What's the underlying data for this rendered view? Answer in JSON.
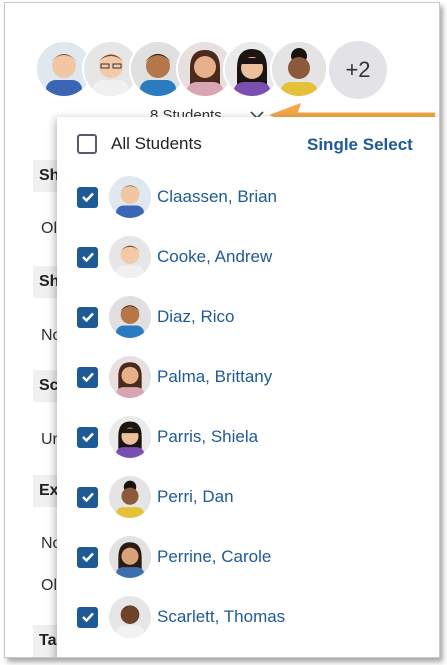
{
  "header": {
    "avatars": [
      {
        "name": "Claassen, Brian",
        "skin": "#f1c7a3",
        "hair": "#8a5a2b",
        "bg": "#dfe7ef",
        "shirt": "#3b66b5"
      },
      {
        "name": "Cooke, Andrew",
        "skin": "#f3c9a8",
        "hair": "#6d4727",
        "bg": "#e6e6e6",
        "shirt": "#f0f0f0"
      },
      {
        "name": "Diaz, Rico",
        "skin": "#b5764a",
        "hair": "#2b1a10",
        "bg": "#e0e0e0",
        "shirt": "#2b7bc0"
      },
      {
        "name": "Palma, Brittany",
        "skin": "#e8b08a",
        "hair": "#4a2a1a",
        "bg": "#e8e0e0",
        "shirt": "#d9a4b3"
      },
      {
        "name": "Parris, Shiela",
        "skin": "#ecc09c",
        "hair": "#1c1410",
        "bg": "#eaeaea",
        "shirt": "#7a4fb0"
      },
      {
        "name": "Perri, Dan",
        "skin": "#8a5a3a",
        "hair": "#1a120c",
        "bg": "#e4e4e4",
        "shirt": "#e5c13a"
      }
    ],
    "more_count": "+2",
    "summary": "8 Students"
  },
  "background": {
    "labels": [
      "Sh",
      "Sh",
      "Sc",
      "Ex",
      "Ta"
    ],
    "values": [
      "Ol",
      "No",
      "Ur",
      "No",
      "Ol"
    ]
  },
  "dropdown": {
    "all_label": "All Students",
    "single_select_label": "Single Select",
    "students": [
      {
        "name": "Claassen, Brian",
        "checked": true
      },
      {
        "name": "Cooke, Andrew",
        "checked": true
      },
      {
        "name": "Diaz, Rico",
        "checked": true
      },
      {
        "name": "Palma, Brittany",
        "checked": true
      },
      {
        "name": "Parris, Shiela",
        "checked": true
      },
      {
        "name": "Perri, Dan",
        "checked": true
      },
      {
        "name": "Perrine, Carole",
        "checked": true
      },
      {
        "name": "Scarlett, Thomas",
        "checked": true
      }
    ]
  },
  "colors": {
    "accent": "#1e5a96",
    "arrow": "#f4a747"
  }
}
